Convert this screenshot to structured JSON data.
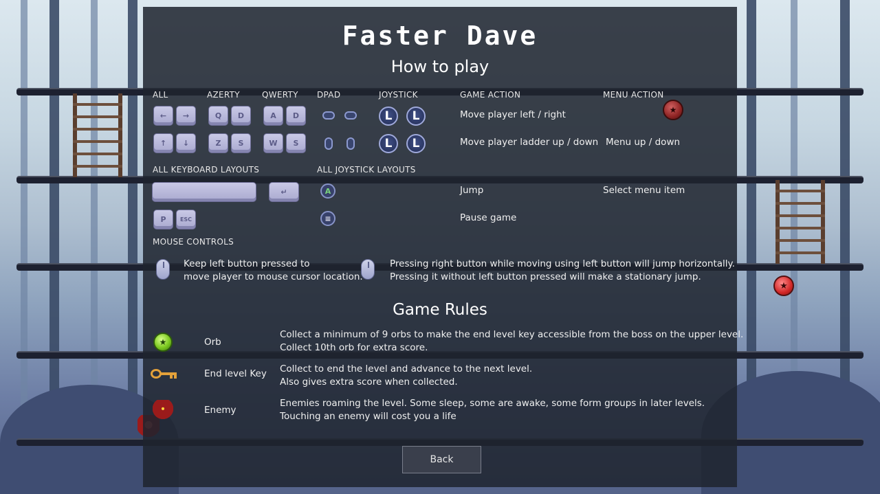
{
  "game": {
    "title": "Faster Dave",
    "subtitle": "How to play"
  },
  "controls": {
    "headers": {
      "all": "ALL",
      "azerty": "AZERTY",
      "qwerty": "QWERTY",
      "dpad": "DPAD",
      "joystick": "JOYSTICK",
      "game_action": "GAME ACTION",
      "menu_action": "MENU ACTION",
      "all_keyboard_layouts": "ALL KEYBOARD LAYOUTS",
      "all_joystick_layouts": "ALL JOYSTICK LAYOUTS",
      "mouse_controls": "MOUSE CONTROLS"
    },
    "keys": {
      "left_arrow": "←",
      "right_arrow": "→",
      "up_arrow": "↑",
      "down_arrow": "↓",
      "azerty_left": "Q",
      "azerty_right": "D",
      "azerty_up": "Z",
      "azerty_down": "S",
      "qwerty_left": "A",
      "qwerty_right": "D",
      "qwerty_up": "W",
      "qwerty_down": "S",
      "stick_label": "L",
      "enter": "↵",
      "pause_key": "P",
      "esc_key": "ESC",
      "jump_button": "A",
      "menu_button": "≡"
    },
    "rows": {
      "move_lr": "Move player left / right",
      "move_ladder": "Move player ladder up / down",
      "menu_ud": "Menu up / down",
      "jump": "Jump",
      "select_menu": "Select menu item",
      "pause": "Pause game"
    },
    "mouse": {
      "left_line1": "Keep left  button  pressed to",
      "left_line2": "move player to mouse cursor location.",
      "right_line1": "Pressing right button while moving using left  button will jump horizontally.",
      "right_line2": "Pressing it without left button pressed will make a stationary jump."
    }
  },
  "rules": {
    "title": "Game Rules",
    "items": [
      {
        "name": "Orb",
        "icon": "green-orb-icon",
        "line1": "Collect a minimum of 9 orbs to make the end level key accessible from the boss on the upper level.",
        "line2": "Collect 10th orb for extra score."
      },
      {
        "name": "End level Key",
        "icon": "key-icon",
        "line1": "Collect to end the level and advance to the next level.",
        "line2": "Also gives extra score when collected."
      },
      {
        "name": "Enemy",
        "icon": "enemy-icon",
        "line1": "Enemies roaming the level. Some sleep, some are awake, some form groups in later levels.",
        "line2": "Touching an enemy will cost you a life"
      }
    ]
  },
  "back_button": "Back",
  "colors": {
    "panel": "#1e242e",
    "key_face": "#c9c9e6",
    "orb_red": "#d22828",
    "orb_green": "#7cc920",
    "key_gold": "#e3a13a"
  },
  "sprites": {
    "orb_star": "★"
  }
}
